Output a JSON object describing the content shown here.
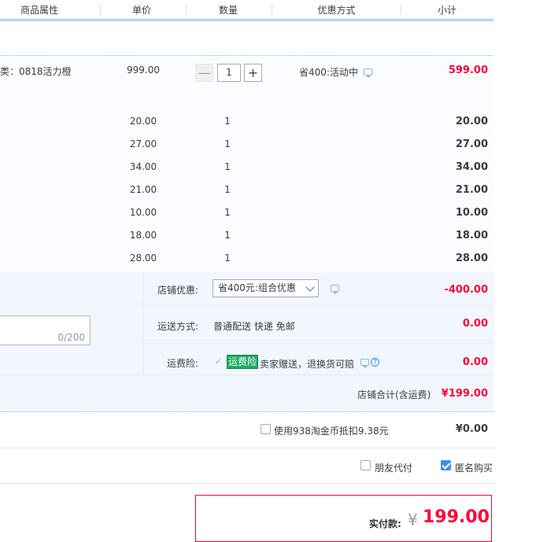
{
  "header": {
    "columns": [
      "商品属性",
      "单价",
      "数量",
      "优惠方式",
      "小计"
    ]
  },
  "main_item": {
    "attribute": "类：0818活力橙",
    "unit_price": "999.00",
    "quantity": "1",
    "minus_symbol": "—",
    "plus_symbol": "+",
    "discount_text": "省400:活动中",
    "subtotal": "599.00"
  },
  "gift_items": [
    {
      "unit_price": "20.00",
      "quantity": "1",
      "subtotal": "20.00"
    },
    {
      "unit_price": "27.00",
      "quantity": "1",
      "subtotal": "27.00"
    },
    {
      "unit_price": "34.00",
      "quantity": "1",
      "subtotal": "34.00"
    },
    {
      "unit_price": "21.00",
      "quantity": "1",
      "subtotal": "21.00"
    },
    {
      "unit_price": "10.00",
      "quantity": "1",
      "subtotal": "10.00"
    },
    {
      "unit_price": "18.00",
      "quantity": "1",
      "subtotal": "18.00"
    },
    {
      "unit_price": "28.00",
      "quantity": "1",
      "subtotal": "28.00"
    }
  ],
  "shop": {
    "discount_label": "店铺优惠:",
    "discount_selected": "省400元:组合优惠",
    "discount_amount": "-400.00",
    "shipping_label": "运送方式:",
    "shipping_value": "普通配送 快递 免邮",
    "shipping_amount": "0.00",
    "insurance_label": "运费险:",
    "insurance_check": "✓",
    "insurance_badge": "运费险",
    "insurance_text": "卖家赠送，退换货可赔",
    "insurance_help": "?",
    "insurance_amount": "0.00",
    "memo_count": "0/200",
    "total_label": "店铺合计(含运费)",
    "total_value": "¥199.00"
  },
  "coins": {
    "label": "使用938淘金币抵扣9.38元",
    "amount": "¥0.00"
  },
  "options": {
    "friend_pay": "朋友代付",
    "anonymous": "匿名购买"
  },
  "payment": {
    "label": "实付款:",
    "currency": "¥",
    "amount": "199.00"
  }
}
